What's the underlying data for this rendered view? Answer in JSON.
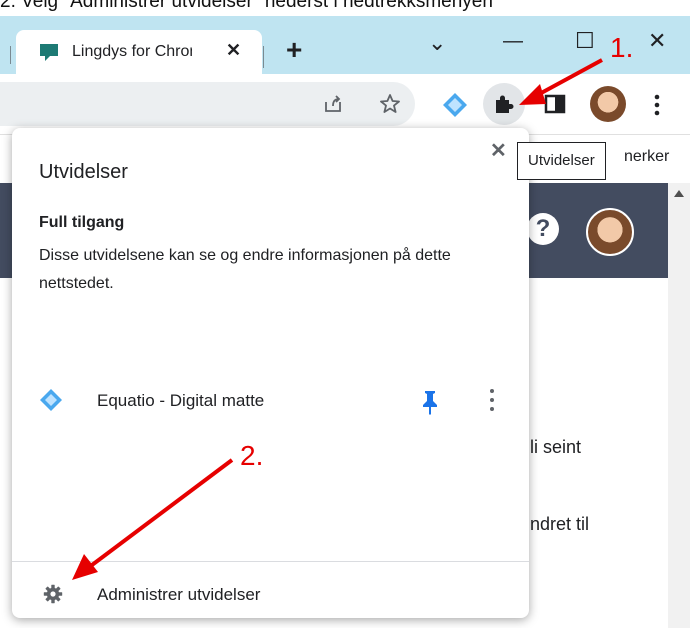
{
  "caption": "2. Velg \"Administrer utvidelser\" nederst i nedtrekksmenyen",
  "browser": {
    "tab": {
      "title": "Lingdys for Chrome",
      "close_glyph": "✕"
    },
    "new_tab_glyph": "+",
    "window_controls": {
      "tab_search": "⌄",
      "minimize": "—",
      "maximize": "☐",
      "close": "✕"
    },
    "colors": {
      "tabbar": "#bfe4f1",
      "omnibox": "#eceff1",
      "page_header": "#434c60",
      "annotation": "#e60000",
      "pin": "#1a73e8"
    }
  },
  "tooltip": "Utvidelser",
  "popup": {
    "title": "Utvidelser",
    "close_glyph": "✕",
    "section_title": "Full tilgang",
    "section_description": "Disse utvidelsene kan se og endre informasjonen på dette nettstedet.",
    "extensions": [
      {
        "name": "Equatio - Digital matte",
        "icon": "equatio-icon",
        "pinned": true
      }
    ],
    "manage_label": "Administrer utvidelser"
  },
  "background_page": {
    "bookmark_text": "nerker",
    "help_glyph": "?",
    "text_line_1": "li seint",
    "text_line_2": "ndret til"
  },
  "annotations": {
    "step1": "1.",
    "step2": "2."
  }
}
